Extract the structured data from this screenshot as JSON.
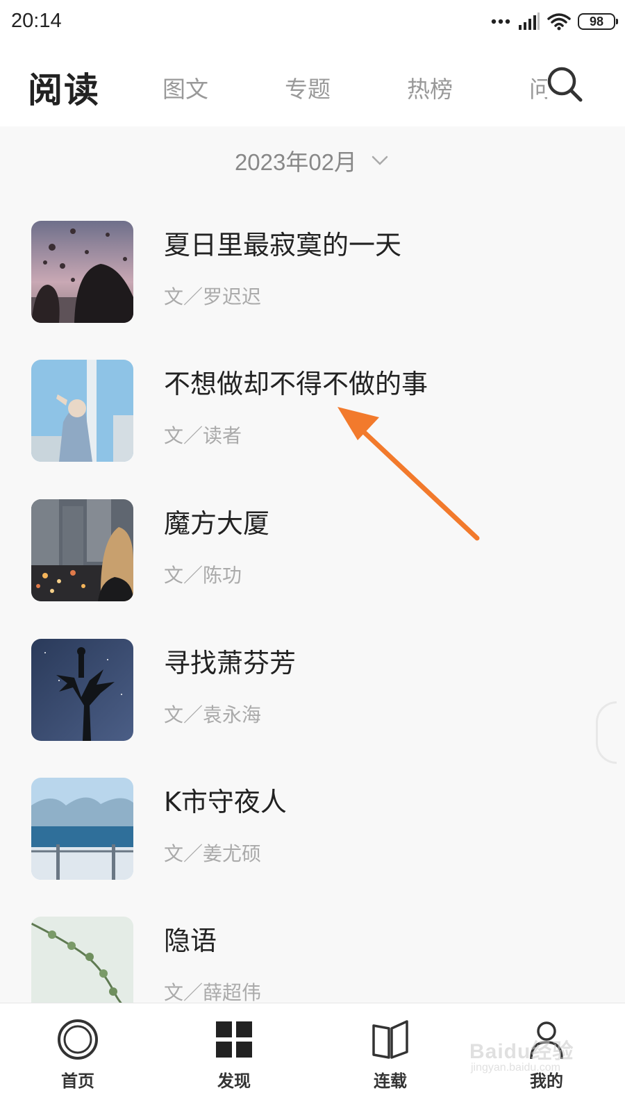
{
  "status_bar": {
    "time": "20:14",
    "battery": "98"
  },
  "header": {
    "title": "阅读",
    "tabs": [
      "图文",
      "专题",
      "热榜",
      "问答"
    ]
  },
  "date_selector": {
    "label": "2023年02月"
  },
  "articles": [
    {
      "title": "夏日里最寂寞的一天",
      "author": "文／罗迟迟"
    },
    {
      "title": "不想做却不得不做的事",
      "author": "文／读者"
    },
    {
      "title": "魔方大厦",
      "author": "文／陈功"
    },
    {
      "title": "寻找萧芬芳",
      "author": "文／袁永海"
    },
    {
      "title": "K市守夜人",
      "author": "文／姜尤硕"
    },
    {
      "title": "隐语",
      "author": "文／薛超伟"
    }
  ],
  "bottom_nav": [
    {
      "label": "首页",
      "icon": "home-circle-icon"
    },
    {
      "label": "发现",
      "icon": "grid-icon"
    },
    {
      "label": "连载",
      "icon": "book-icon"
    },
    {
      "label": "我的",
      "icon": "user-icon"
    }
  ],
  "watermark": {
    "text": "Baidu经验",
    "sub": "jingyan.baidu.com"
  },
  "colors": {
    "annotation_arrow": "#f27a2c",
    "title_text": "#222222",
    "muted_text": "#aaaaaa"
  }
}
